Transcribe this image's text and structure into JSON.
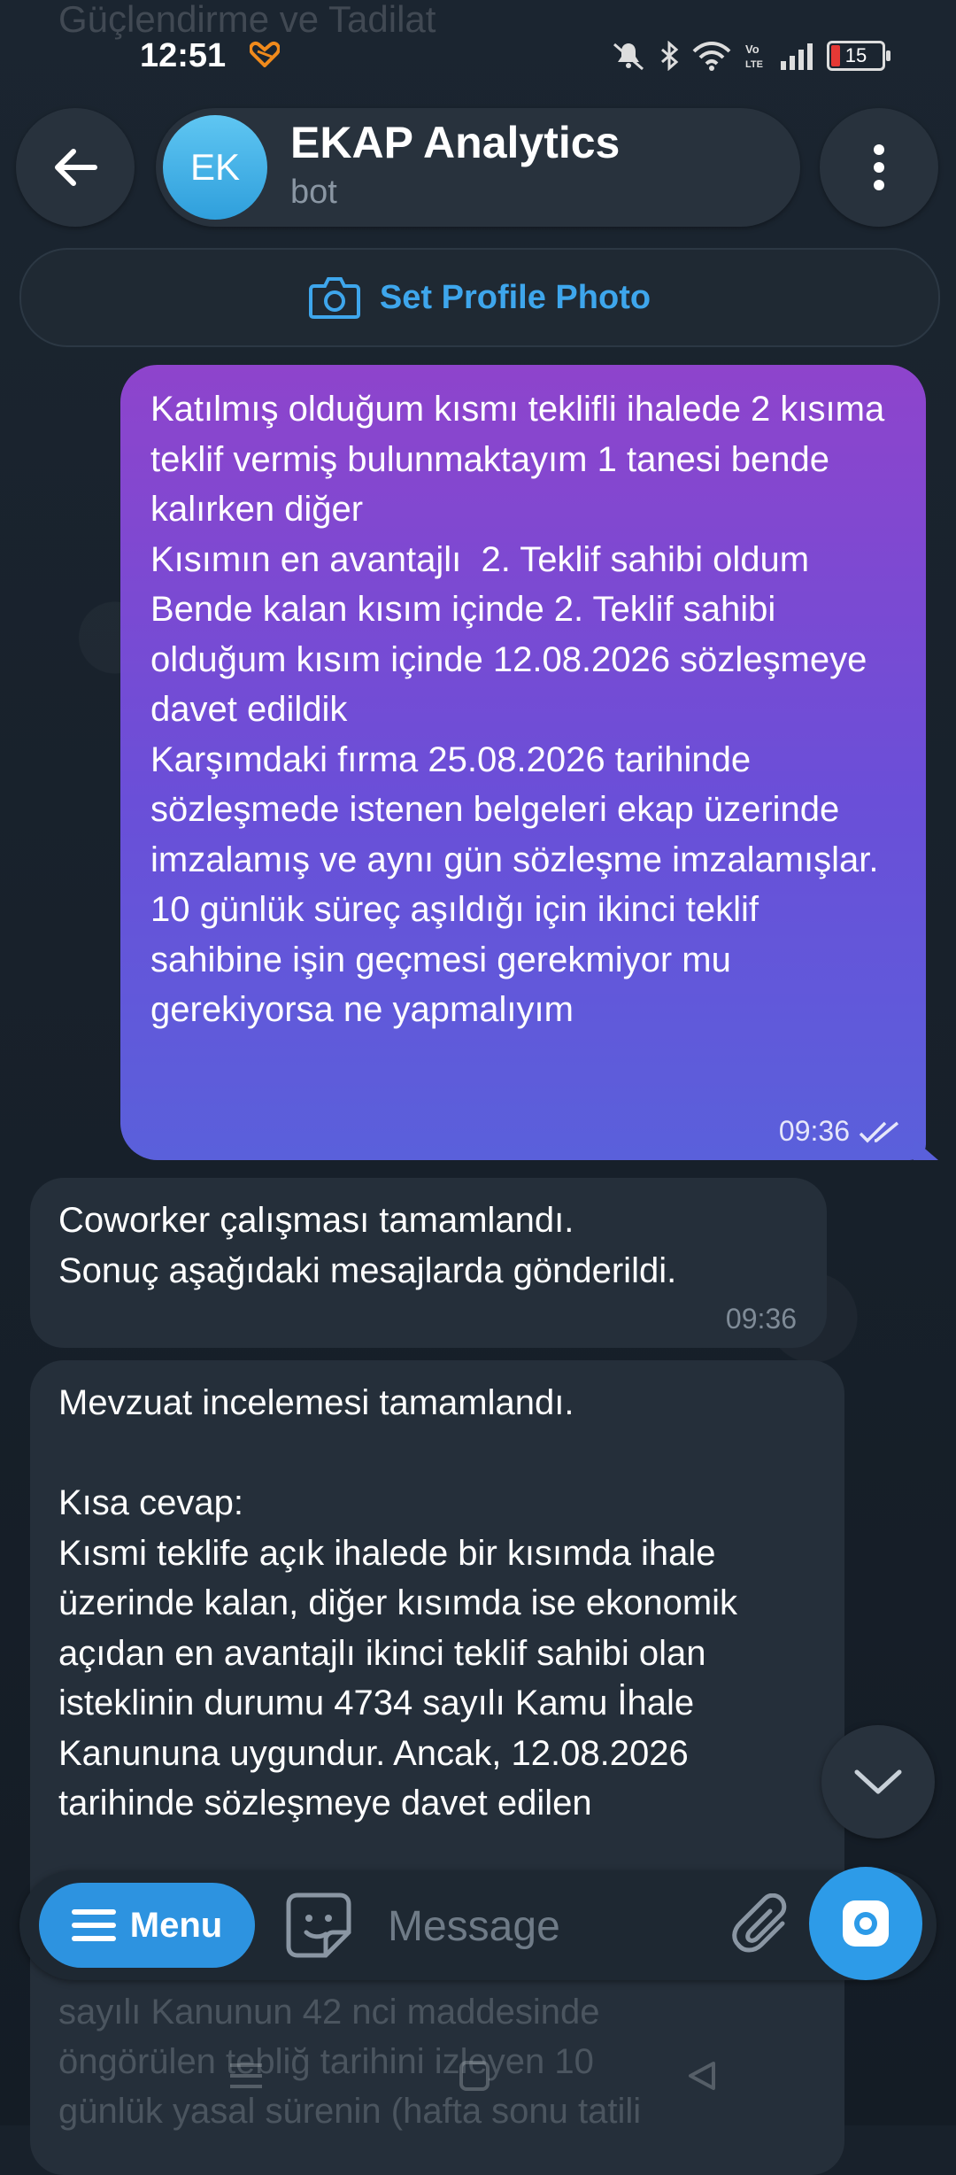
{
  "status_bar": {
    "time": "12:51",
    "battery": "15"
  },
  "ghost": {
    "top_line_1": "Güçlendirme ve Tadilat",
    "top_line_2": "",
    "bottom_text": "sayılı Kanunun 42 nci maddesinde\nöngörülen tebliğ tarihini izleyen 10\ngünlük yasal sürenin (hafta sonu tatili"
  },
  "header": {
    "avatar_initials": "EK",
    "title": "EKAP Analytics",
    "subtitle": "bot"
  },
  "profile_photo": {
    "label": "Set Profile Photo"
  },
  "messages": {
    "outgoing": {
      "text": "Katılmış olduğum kısmı teklifli ihalede 2 kısıma teklif vermiş bulunmaktayım 1 tanesi bende kalırken diğer\nKısımın en avantajlı  2. Teklif sahibi oldum\nBende kalan kısım içinde 2. Teklif sahibi olduğum kısım içinde 12.08.2026 sözleşmeye davet edildik\nKarşımdaki fırma 25.08.2026 tarihinde sözleşmede istenen belgeleri ekap üzerinde imzalamış ve aynı gün sözleşme imzalamışlar.\n10 günlük süreç aşıldığı için ikinci teklif sahibine işin geçmesi gerekmiyor mu gerekiyorsa ne yapmalıyım",
      "time": "09:36"
    },
    "incoming_1": {
      "text": "Coworker çalışması tamamlandı.\nSonuç aşağıdaki mesajlarda gönderildi.",
      "time": "09:36"
    },
    "incoming_2": {
      "text": "Mevzuat incelemesi tamamlandı.\n\nKısa cevap:\nKısmi teklife açık ihalede bir kısımda ihale üzerinde kalan, diğer kısımda ise ekonomik açıdan en avantajlı ikinci teklif sahibi olan isteklinin durumu 4734 sayılı Kamu İhale Kanununa uygundur. Ancak, 12.08.2026 tarihinde sözleşmeye davet edilen"
    }
  },
  "composer": {
    "menu_label": "Menu",
    "placeholder": "Message"
  },
  "colors": {
    "accent": "#2d93e0",
    "outgoing_top": "#8e44cc",
    "outgoing_bottom": "#5a60db",
    "incoming": "#252f3a",
    "background": "#18212b"
  },
  "icons": [
    "back-arrow-icon",
    "more-vertical-icon",
    "camera-icon",
    "read-checks-icon",
    "chevron-down-icon",
    "menu-icon",
    "sticker-icon",
    "paperclip-icon",
    "camera-shutter-icon"
  ]
}
